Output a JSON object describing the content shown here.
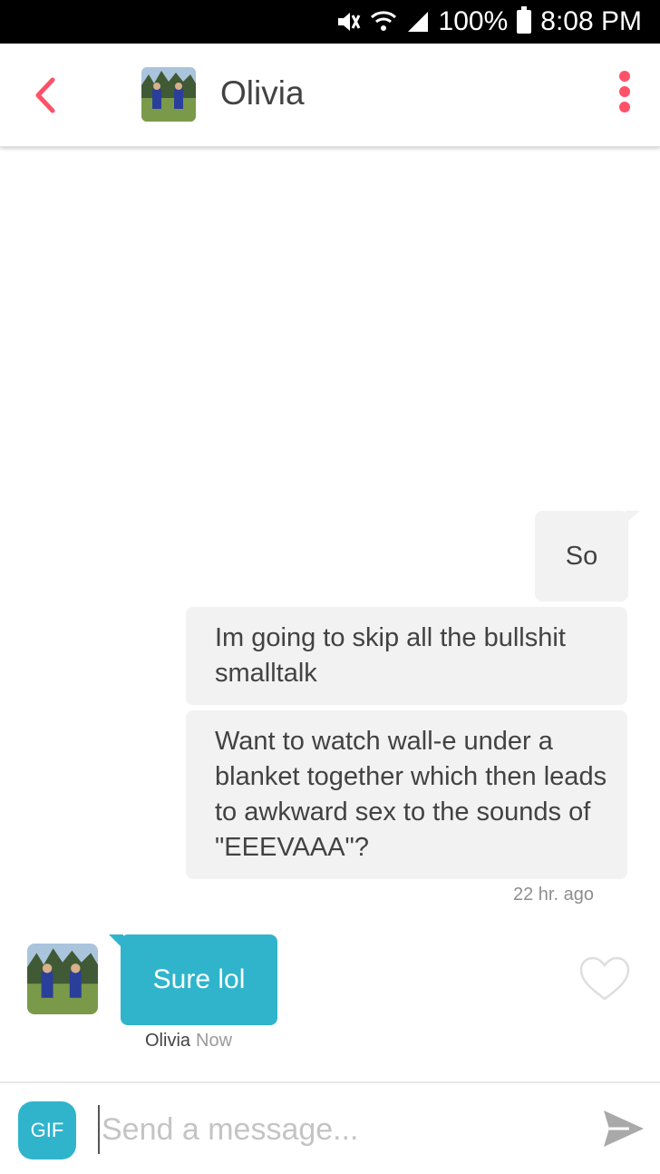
{
  "status_bar": {
    "icons": [
      "mute-icon",
      "wifi-icon",
      "signal-icon",
      "battery-icon"
    ],
    "battery_percent": "100%",
    "time": "8:08 PM"
  },
  "header": {
    "back_icon": "chevron-left-icon",
    "contact_name": "Olivia",
    "menu_icon": "more-vertical-icon",
    "accent_color": "#fe5268"
  },
  "messages": {
    "outgoing": [
      {
        "text": "So"
      },
      {
        "text": "Im going to skip all the bullshit smalltalk"
      },
      {
        "text": "Want to watch wall-e under a blanket together which then leads to awkward sex to the sounds of \"EEEVAAA\"?"
      }
    ],
    "outgoing_timestamp": "22 hr. ago",
    "incoming": {
      "text": "Sure lol",
      "sender": "Olivia",
      "time": "Now",
      "bubble_color": "#2fb4cc"
    }
  },
  "compose": {
    "gif_label": "GIF",
    "placeholder": "Send a message...",
    "send_icon": "send-icon"
  }
}
